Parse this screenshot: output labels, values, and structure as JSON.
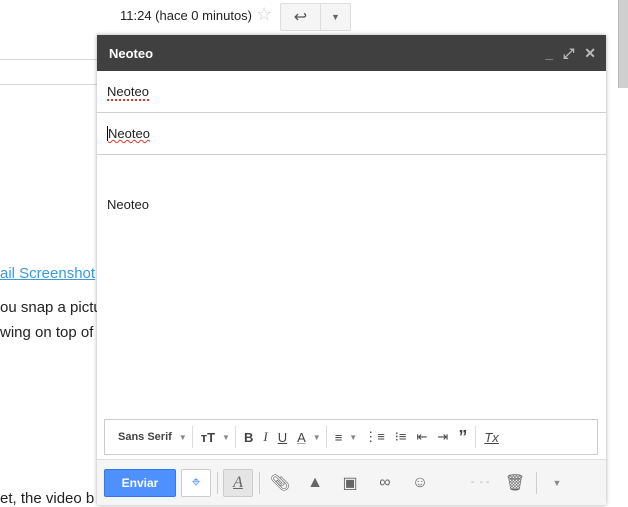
{
  "background": {
    "link_text": "ail Screenshot",
    "line1": "ou snap a pictu",
    "line2": "wing on top of",
    "line3": "et, the video b",
    "link_color": "#3a9ad9"
  },
  "message": {
    "time": "11:24 (hace 0 minutos)"
  },
  "compose": {
    "title": "Neoteo",
    "to": "Neoteo",
    "subject": "Neoteo",
    "body": "Neoteo",
    "header_color": "#404040"
  },
  "formatting": {
    "font": "Sans Serif"
  },
  "bottom": {
    "send_label": "Enviar",
    "send_color": "#4d90fe"
  }
}
